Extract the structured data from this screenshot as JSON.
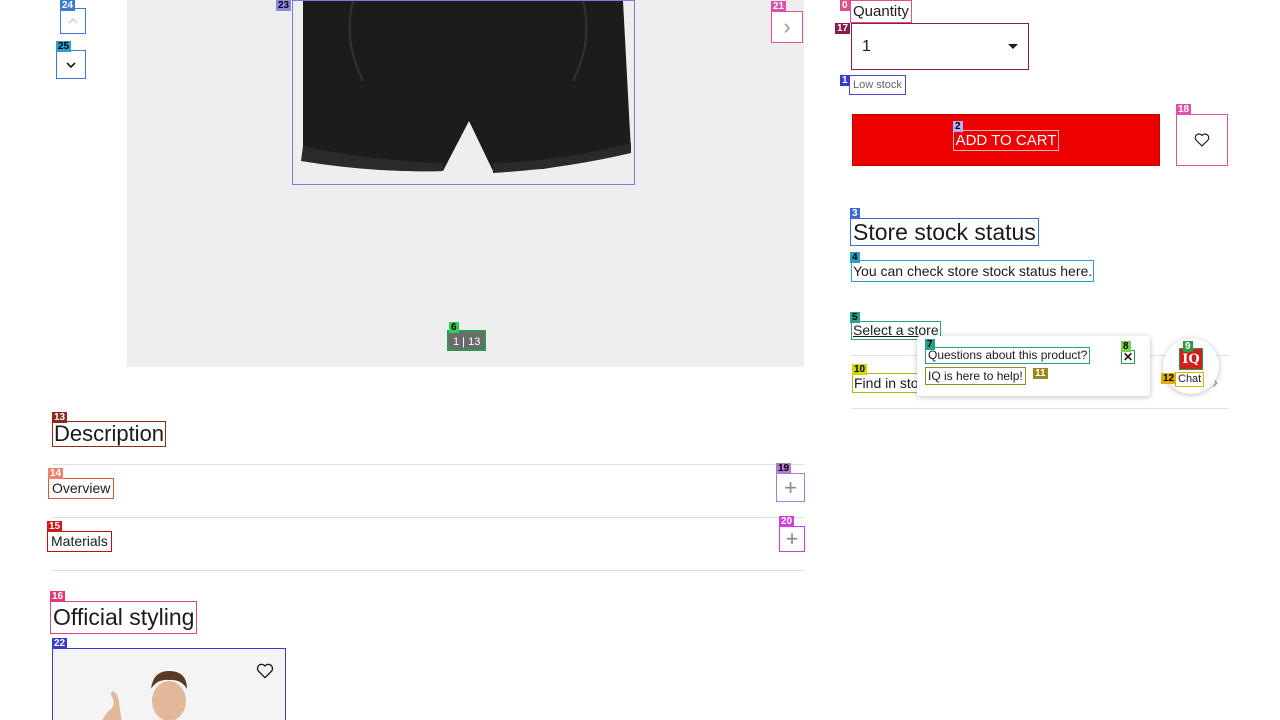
{
  "gallery": {
    "counter": "1 | 13",
    "next_label": "›"
  },
  "purchase": {
    "quantity_label": "Quantity",
    "quantity_value": "1",
    "low_stock": "Low stock",
    "add_to_cart": "ADD TO CART"
  },
  "store": {
    "title": "Store stock status",
    "description": "You can check store stock status here.",
    "select_store": "Select a store",
    "find_in_store": "Find in store"
  },
  "chat": {
    "question": "Questions about this product?",
    "help": "IQ is here to help!",
    "fab_logo": "IQ",
    "fab_label": "Chat",
    "close": "✕"
  },
  "description": {
    "title": "Description",
    "items": [
      {
        "label": "Overview"
      },
      {
        "label": "Materials"
      }
    ]
  },
  "styling": {
    "title": "Official styling"
  },
  "overlay_tags": [
    "0",
    "1",
    "2",
    "3",
    "4",
    "5",
    "6",
    "7",
    "8",
    "9",
    "10",
    "11",
    "12",
    "13",
    "14",
    "15",
    "16",
    "17",
    "18",
    "19",
    "20",
    "21",
    "22",
    "23",
    "24",
    "25"
  ],
  "colors": {
    "accent_red": "#ed0000",
    "gallery_bg": "#eeeeee"
  }
}
